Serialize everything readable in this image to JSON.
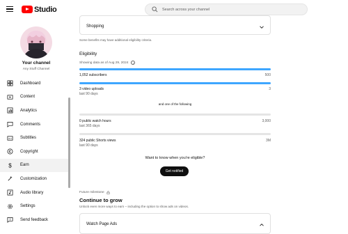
{
  "header": {
    "logo_text": "Studio",
    "search_placeholder": "Search across your channel"
  },
  "channel": {
    "title": "Your channel",
    "subtitle": "Any Stuff Channel"
  },
  "sidebar": {
    "items": [
      {
        "label": "Dashboard",
        "icon": "dashboard-icon"
      },
      {
        "label": "Content",
        "icon": "content-icon"
      },
      {
        "label": "Analytics",
        "icon": "analytics-icon"
      },
      {
        "label": "Comments",
        "icon": "comments-icon"
      },
      {
        "label": "Subtitles",
        "icon": "subtitles-icon"
      },
      {
        "label": "Copyright",
        "icon": "copyright-icon"
      },
      {
        "label": "Earn",
        "icon": "earn-icon",
        "active": true
      },
      {
        "label": "Customization",
        "icon": "customization-icon"
      },
      {
        "label": "Audio library",
        "icon": "audio-library-icon"
      },
      {
        "label": "Settings",
        "icon": "gear-icon"
      },
      {
        "label": "Send feedback",
        "icon": "feedback-icon"
      }
    ]
  },
  "main": {
    "shopping_card_title": "Shopping",
    "benefits_note": "Some benefits may have additional eligibility criteria.",
    "eligibility_title": "Eligibility",
    "eligibility_date": "Showing data as of Aug 29, 2024",
    "subscribers": {
      "label": "1,052 subscribers",
      "required": "500",
      "progress": 1.0
    },
    "uploads": {
      "label": "3 video uploads",
      "sub": "last 90 days",
      "required": "3",
      "progress": 1.0
    },
    "one_of_following": "and one of the following",
    "watch_hours": {
      "label": "0 public watch hours",
      "sub": "last 365 days",
      "required": "3,000",
      "progress": 0.0
    },
    "shorts_views": {
      "label": "324 public Shorts views",
      "sub": "last 90 days",
      "required": "3M",
      "progress": 0.0
    },
    "want_to_know": "Want to know when you're eligible?",
    "get_notified_button": "Get notified",
    "future_milestone": "Future milestone",
    "continue_title": "Continue to grow",
    "continue_desc": "Unlock even more ways to earn – including the option to show ads on videos.",
    "watch_page_ads_title": "Watch Page Ads"
  },
  "colors": {
    "progress_fill": "#3ea6ff",
    "progress_track": "#e5e5e5",
    "brand_red": "#ff0000",
    "active_bg": "#f2f2f2"
  }
}
